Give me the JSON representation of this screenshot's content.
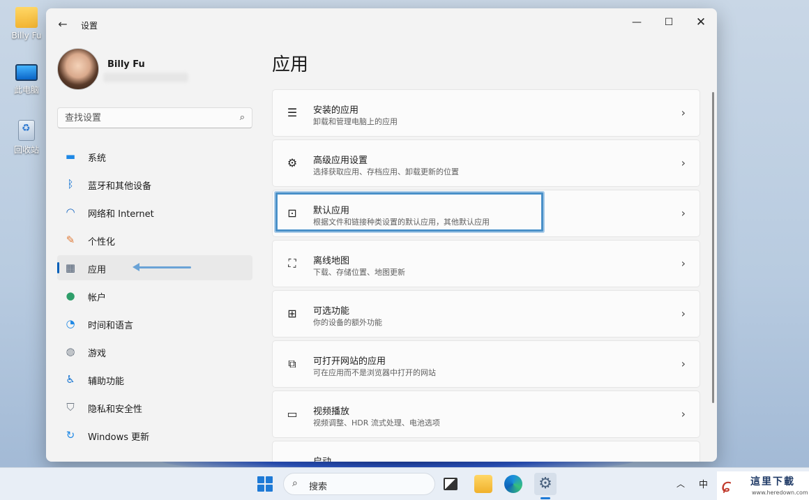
{
  "desktop": {
    "icons": [
      {
        "label": "Billy Fu",
        "icon": "folder-icon"
      },
      {
        "label": "此电脑",
        "icon": "this-pc-icon"
      },
      {
        "label": "回收站",
        "icon": "recycle-bin-icon"
      }
    ]
  },
  "window": {
    "app_title": "设置",
    "controls": {
      "minimize": "—",
      "maximize": "☐",
      "close": "✕"
    }
  },
  "profile": {
    "name": "Billy Fu"
  },
  "search": {
    "placeholder": "查找设置"
  },
  "nav": {
    "items": [
      {
        "label": "系统",
        "icon": "system-icon",
        "icon_color": "#1e88e5"
      },
      {
        "label": "蓝牙和其他设备",
        "icon": "bluetooth-icon",
        "icon_color": "#0a6ed1"
      },
      {
        "label": "网络和 Internet",
        "icon": "wifi-icon",
        "icon_color": "#1565c0"
      },
      {
        "label": "个性化",
        "icon": "brush-icon",
        "icon_color": "#e07b39"
      },
      {
        "label": "应用",
        "icon": "apps-icon",
        "icon_color": "#4a5a70",
        "active": true
      },
      {
        "label": "帐户",
        "icon": "account-icon",
        "icon_color": "#2e9e6a"
      },
      {
        "label": "时间和语言",
        "icon": "time-language-icon",
        "icon_color": "#1e88e5"
      },
      {
        "label": "游戏",
        "icon": "game-controller-icon",
        "icon_color": "#707a86"
      },
      {
        "label": "辅助功能",
        "icon": "accessibility-icon",
        "icon_color": "#1976d2"
      },
      {
        "label": "隐私和安全性",
        "icon": "shield-icon",
        "icon_color": "#6d7682"
      },
      {
        "label": "Windows 更新",
        "icon": "windows-update-icon",
        "icon_color": "#1e88e5"
      }
    ]
  },
  "main": {
    "title": "应用",
    "cards": [
      {
        "title": "安装的应用",
        "desc": "卸载和管理电脑上的应用",
        "icon": "installed-apps-icon"
      },
      {
        "title": "高级应用设置",
        "desc": "选择获取应用、存档应用、卸载更新的位置",
        "icon": "advanced-app-settings-icon"
      },
      {
        "title": "默认应用",
        "desc": "根据文件和链接种类设置的默认应用，其他默认应用",
        "icon": "default-apps-icon",
        "highlighted": true
      },
      {
        "title": "离线地图",
        "desc": "下载、存储位置、地图更新",
        "icon": "offline-maps-icon"
      },
      {
        "title": "可选功能",
        "desc": "你的设备的额外功能",
        "icon": "optional-features-icon"
      },
      {
        "title": "可打开网站的应用",
        "desc": "可在应用而不是浏览器中打开的网站",
        "icon": "apps-for-websites-icon"
      },
      {
        "title": "视频播放",
        "desc": "视频调整、HDR 流式处理、电池选项",
        "icon": "video-playback-icon"
      },
      {
        "title": "启动",
        "desc": "",
        "icon": "startup-icon"
      }
    ]
  },
  "taskbar": {
    "search_label": "搜索",
    "ime": "中",
    "accent": "#1e7ad6"
  },
  "watermark": {
    "name": "這里下載",
    "url": "www.heredown.com"
  }
}
